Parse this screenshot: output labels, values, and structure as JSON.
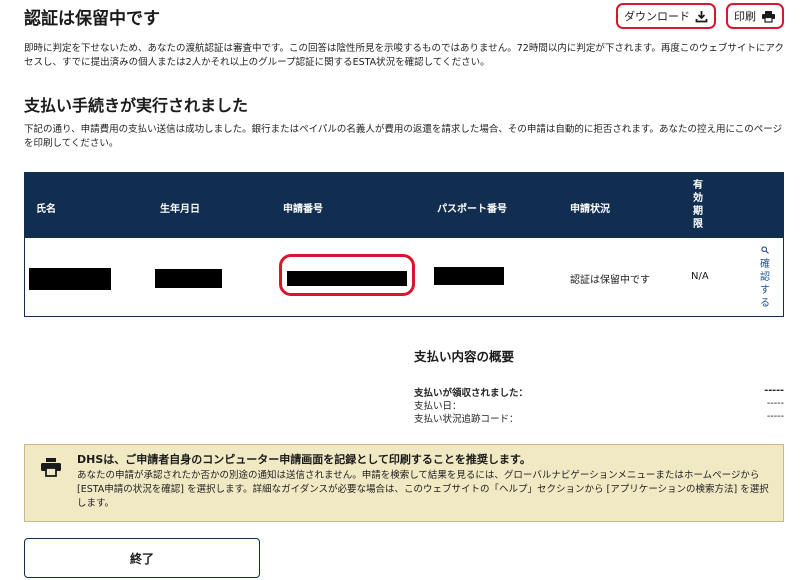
{
  "page": {
    "title": "認証は保留中です",
    "download_label": "ダウンロード",
    "print_label": "印刷",
    "intro": "即時に判定を下せないため、あなたの渡航認証は審査中です。この回答は陰性所見を示唆するものではありません。72時間以内に判定が下されます。再度このウェブサイトにアクセスし、すでに提出済みの個人または2人かそれ以上のグループ認証に関するESTA状況を確認してください。"
  },
  "payment": {
    "title": "支払い手続きが実行されました",
    "description": "下記の通り、申請費用の支払い送信は成功しました。銀行またはペイパルの名義人が費用の返還を請求した場合、その申請は自動的に拒否されます。あなたの控え用にこのページを印刷してください。"
  },
  "table": {
    "headers": {
      "name": "氏名",
      "dob": "生年月日",
      "app_no": "申請番号",
      "passport_no": "パスポート番号",
      "status": "申請状況",
      "validity": "有効期限"
    },
    "row": {
      "status": "認証は保留中です",
      "validity": "N/A",
      "confirm_label": "確認する"
    }
  },
  "summary": {
    "title": "支払い内容の概要",
    "rows": [
      {
        "label": "支払いが領収されました：",
        "value": "-----"
      },
      {
        "label": "支払い日：",
        "value": "-----"
      },
      {
        "label": "支払い状況追跡コード：",
        "value": "-----"
      }
    ]
  },
  "notice": {
    "title": "DHSは、ご申請者自身のコンピューター申請画面を記録として印刷することを推奨します。",
    "body": "あなたの申請が承認されたか否かの別途の通知は送信されません。申請を検索して結果を見るには、グローバルナビゲーションメニューまたはホームページから [ESTA申請の状況を確認] を選択します。詳細なガイダンスが必要な場合は、このウェブサイトの「ヘルプ」セクションから [アプリケーションの検索方法] を選択します。"
  },
  "finish_label": "終了",
  "icons": {
    "download": "download-icon",
    "print": "printer-icon",
    "search": "search-icon"
  },
  "colors": {
    "header_bg": "#112e51",
    "highlight": "#d7172f",
    "notice_bg": "#f1e8c4",
    "link": "#205493"
  }
}
